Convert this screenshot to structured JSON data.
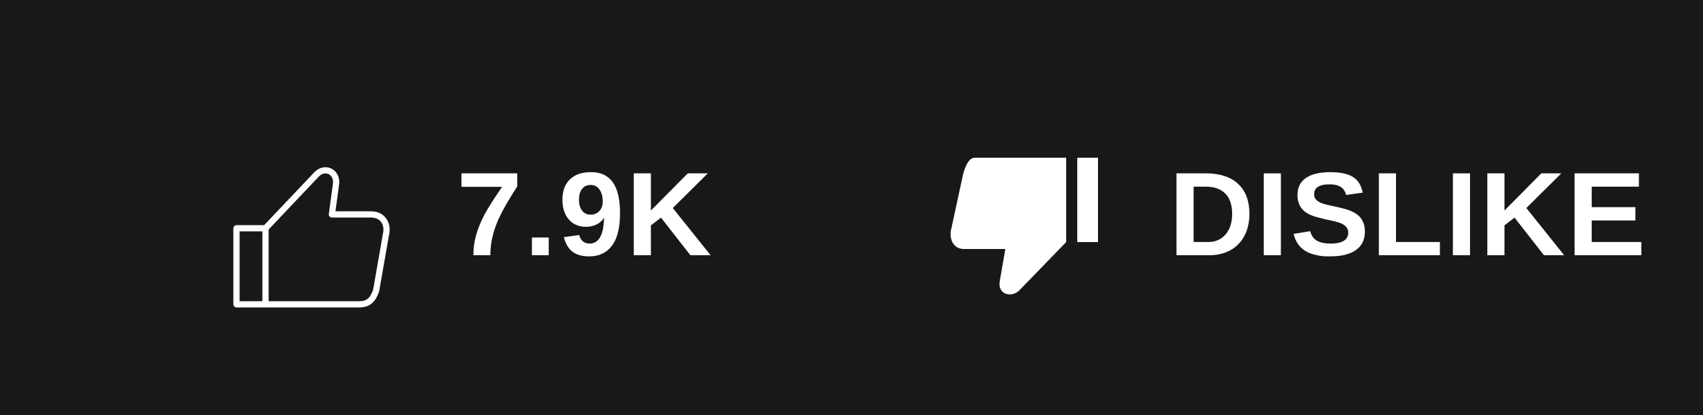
{
  "actions": {
    "like": {
      "icon": "thumbs-up-outline-icon",
      "count": "7.9K"
    },
    "dislike": {
      "icon": "thumbs-down-filled-icon",
      "label": "DISLIKE"
    }
  },
  "colors": {
    "background": "#181818",
    "foreground": "#ffffff"
  }
}
